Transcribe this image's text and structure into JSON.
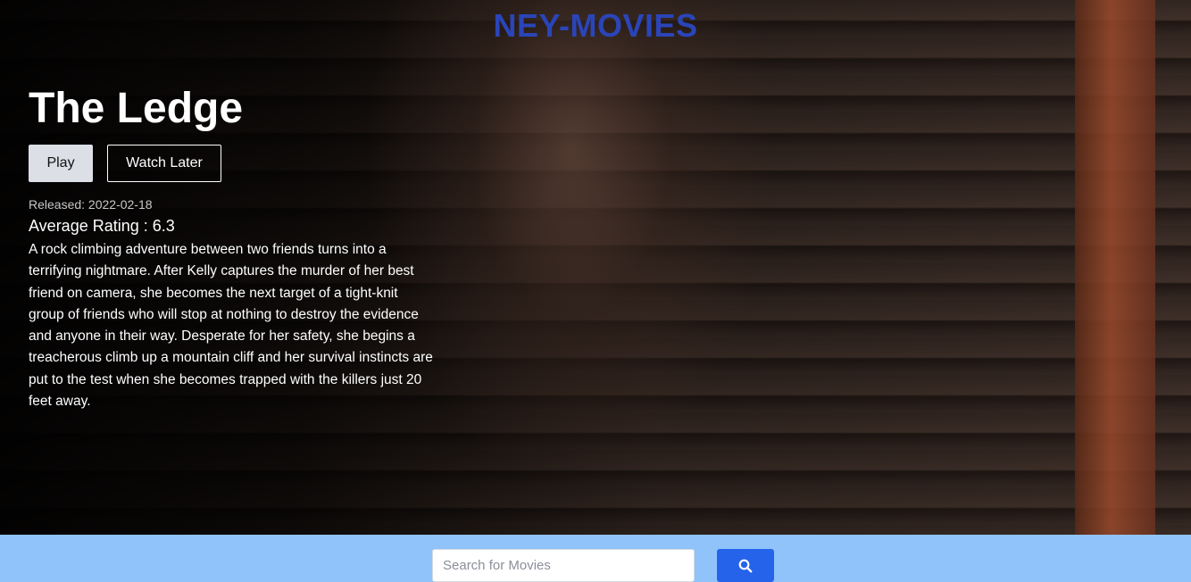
{
  "brand": {
    "name": "NEY-MOVIES",
    "color": "#2a45b8"
  },
  "featured": {
    "title": "The Ledge",
    "play_label": "Play",
    "watch_later_label": "Watch Later",
    "released": "Released: 2022-02-18",
    "rating": "Average Rating : 6.3",
    "overview": "A rock climbing adventure between two friends turns into a terrifying nightmare. After Kelly captures the murder of her best friend on camera, she becomes the next target of a tight-knit group of friends who will stop at nothing to destroy the evidence and anyone in their way. Desperate for her safety, she begins a treacherous climb up a mountain cliff and her survival instincts are put to the test when she becomes trapped with the killers just 20 feet away."
  },
  "search": {
    "placeholder": "Search for Movies",
    "value": "",
    "button_icon": "search-icon",
    "bar_color": "#90c3f9",
    "button_color": "#2563eb"
  }
}
